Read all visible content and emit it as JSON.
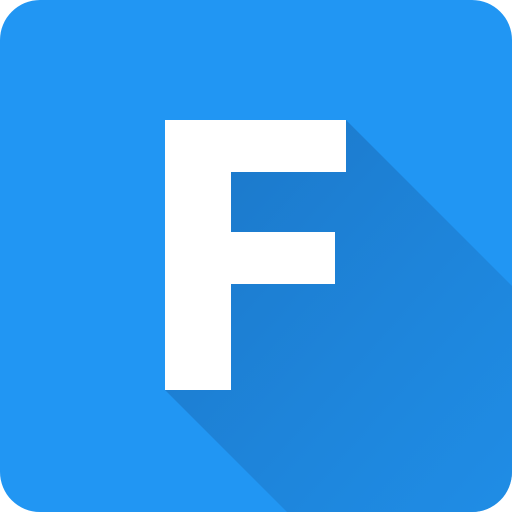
{
  "icon": {
    "letter": "F",
    "colors": {
      "background": "#2196F3",
      "shadow": "#1E7FCF",
      "letter": "#FFFFFF"
    }
  }
}
